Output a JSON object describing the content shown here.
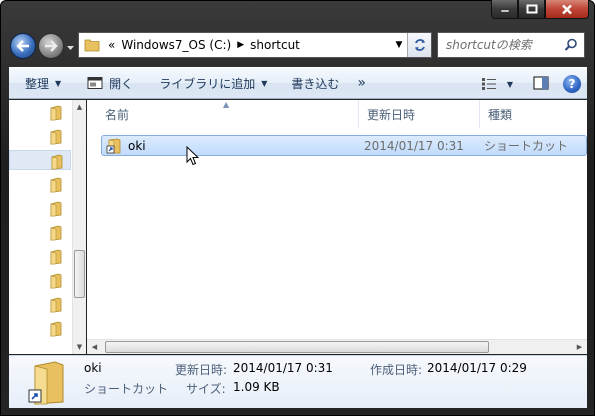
{
  "address": {
    "overflow_chevrons": "«",
    "segments": [
      "Windows7_OS (C:)",
      "shortcut"
    ]
  },
  "search": {
    "placeholder": "shortcutの検索"
  },
  "toolbar": {
    "organize": "整理",
    "open": "開く",
    "library": "ライブラリに追加",
    "burn": "書き込む",
    "more": "»",
    "help": "?"
  },
  "columns": {
    "name": "名前",
    "date": "更新日時",
    "type": "種類"
  },
  "files": [
    {
      "name": "oki",
      "modified": "2014/01/17 0:31",
      "type": "ショートカット"
    }
  ],
  "details": {
    "name": "oki",
    "type": "ショートカット",
    "modified_label": "更新日時:",
    "modified_value": "2014/01/17 0:31",
    "created_label": "作成日時:",
    "created_value": "2014/01/17 0:29",
    "size_label": "サイズ:",
    "size_value": "1.09 KB"
  },
  "colors": {
    "folder": "#e8c060",
    "selection": "#c1dbfc",
    "accent": "#1e395b"
  }
}
